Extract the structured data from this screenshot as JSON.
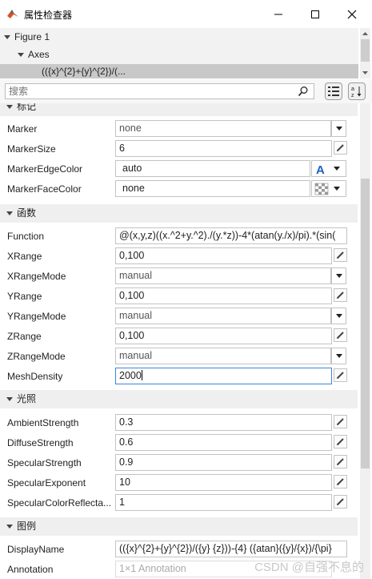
{
  "window": {
    "title": "属性检查器",
    "minimize_glyph": "—",
    "maximize_glyph": "☐",
    "close_glyph": "✕"
  },
  "tree": {
    "figure": "Figure 1",
    "axes": "Axes",
    "selected": "(({x}^{2}+{y}^{2})/(..."
  },
  "search": {
    "placeholder": "搜索"
  },
  "sections": {
    "marker_partial": "标记",
    "function": "函数",
    "lighting": "光照",
    "legend": "图例"
  },
  "props": {
    "marker": {
      "label": "Marker",
      "value": "none"
    },
    "marker_size": {
      "label": "MarkerSize",
      "value": "6"
    },
    "marker_edge_color": {
      "label": "MarkerEdgeColor",
      "value": "auto"
    },
    "marker_face_color": {
      "label": "MarkerFaceColor",
      "value": "none"
    },
    "function": {
      "label": "Function",
      "value": "@(x,y,z)((x.^2+y.^2)./(y.*z))-4*(atan(y./x)/pi).*(sin("
    },
    "xrange": {
      "label": "XRange",
      "value": "0,100"
    },
    "xrange_mode": {
      "label": "XRangeMode",
      "value": "manual"
    },
    "yrange": {
      "label": "YRange",
      "value": "0,100"
    },
    "yrange_mode": {
      "label": "YRangeMode",
      "value": "manual"
    },
    "zrange": {
      "label": "ZRange",
      "value": "0,100"
    },
    "zrange_mode": {
      "label": "ZRangeMode",
      "value": "manual"
    },
    "mesh_density": {
      "label": "MeshDensity",
      "value": "2000"
    },
    "ambient_strength": {
      "label": "AmbientStrength",
      "value": "0.3"
    },
    "diffuse_strength": {
      "label": "DiffuseStrength",
      "value": "0.6"
    },
    "specular_strength": {
      "label": "SpecularStrength",
      "value": "0.9"
    },
    "specular_exponent": {
      "label": "SpecularExponent",
      "value": "10"
    },
    "specular_color_reflectance": {
      "label": "SpecularColorReflecta...",
      "value": "1"
    },
    "display_name": {
      "label": "DisplayName",
      "value": "(({x}^{2}+{y}^{2})/({y} {z}))-{4} ({atan}({y}/{x})/{\\pi}"
    },
    "annotation": {
      "label": "Annotation",
      "value": "1×1 Annotation"
    }
  },
  "watermark": "CSDN @自强不息的",
  "colors": {
    "accent": "#3c86d8",
    "edge_color_icon": "#1f5fbf"
  }
}
